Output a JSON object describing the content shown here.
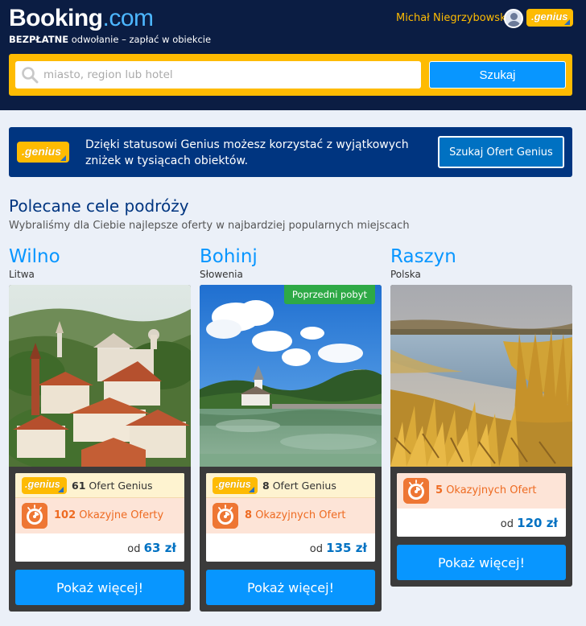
{
  "header": {
    "logo_main": "Booking",
    "logo_suffix": ".com",
    "tagline_bold": "BEZPŁATNE",
    "tagline_rest": " odwołanie – zapłać w obiekcie",
    "user_name": "Michał Niegrzybowski",
    "genius_label": ".genius"
  },
  "search": {
    "placeholder": "miasto, region lub hotel",
    "button_label": "Szukaj"
  },
  "genius_banner": {
    "badge": ".genius",
    "text": "Dzięki statusowi Genius możesz korzystać z wyjątkowych zniżek w tysiącach obiektów.",
    "button_label": "Szukaj Ofert Genius"
  },
  "section": {
    "title": "Polecane cele podróży",
    "subtitle": "Wybraliśmy dla Ciebie najlepsze oferty w najbardziej popularnych miejscach"
  },
  "destinations": [
    {
      "name": "Wilno",
      "country": "Litwa",
      "genius_badge": ".genius",
      "genius_count": "61",
      "genius_text": "Ofert Genius",
      "deal_count": "102",
      "deal_text": "Okazyjne Oferty",
      "price_prefix": "od",
      "price": "63 zł",
      "button_label": "Pokaż więcej!"
    },
    {
      "name": "Bohinj",
      "country": "Słowenia",
      "badge": "Poprzedni pobyt",
      "genius_badge": ".genius",
      "genius_count": "8",
      "genius_text": "Ofert Genius",
      "deal_count": "8",
      "deal_text": "Okazyjnych Ofert",
      "price_prefix": "od",
      "price": "135 zł",
      "button_label": "Pokaż więcej!"
    },
    {
      "name": "Raszyn",
      "country": "Polska",
      "deal_count": "5",
      "deal_text": "Okazyjnych Ofert",
      "price_prefix": "od",
      "price": "120 zł",
      "button_label": "Pokaż więcej!"
    }
  ],
  "colors": {
    "header_bg": "#0b1d43",
    "brand_yellow": "#febb02",
    "brand_blue": "#003580",
    "action_blue": "#0896ff",
    "deal_orange": "#ee7633",
    "prev_stay_green": "#2ea946"
  }
}
